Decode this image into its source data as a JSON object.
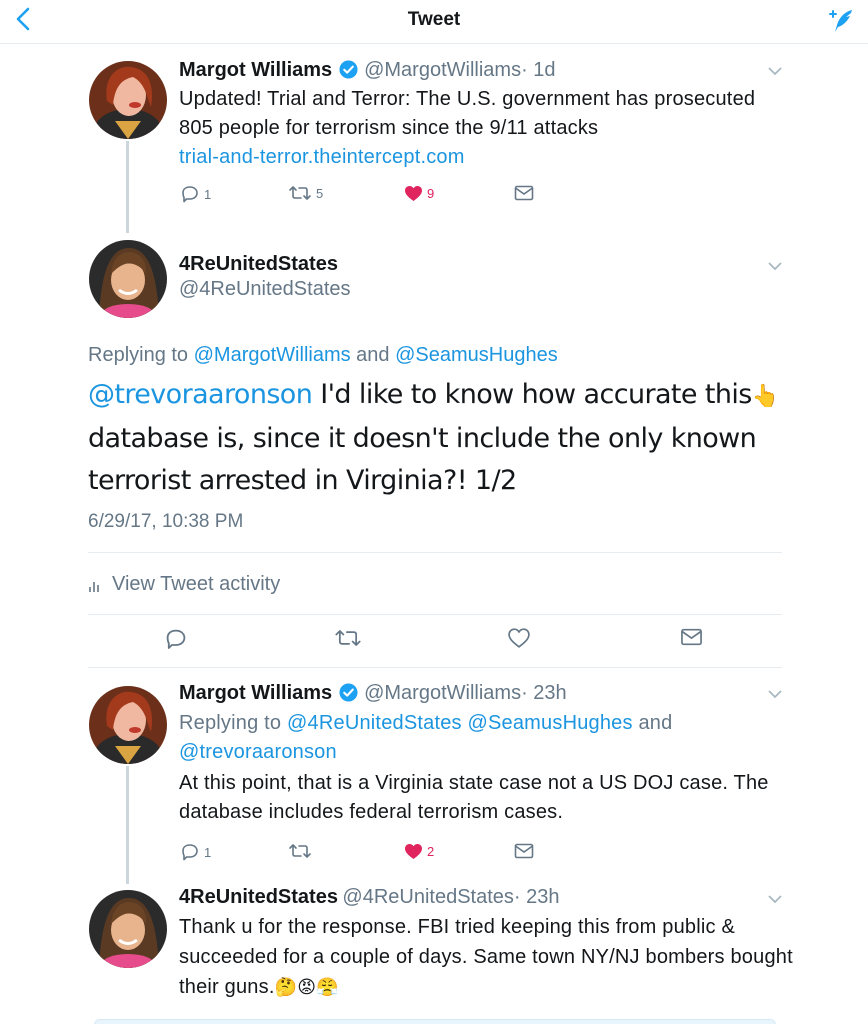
{
  "header": {
    "title": "Tweet"
  },
  "tweet1": {
    "name": "Margot Williams",
    "handle": "@MargotWilliams",
    "time": "· 1d",
    "text": "Updated! Trial and Terror: The U.S. government has prosecuted 805 people for terrorism since the 9/11 attacks",
    "link": "trial-and-terror.theintercept.com",
    "replies": "1",
    "retweets": "5",
    "likes": "9"
  },
  "main": {
    "name": "4ReUnitedStates",
    "handle": "@4ReUnitedStates",
    "replying_prefix": "Replying to",
    "replying_user1": "@MargotWilliams",
    "replying_and": "and",
    "replying_user2": "@SeamusHughes",
    "mention": "@trevoraaronson",
    "text_part1": " I'd like to know how accurate this",
    "text_part2": "database is, since it doesn't include the only known terrorist arrested in Virginia?! 1/2",
    "pointing_emoji": "👆",
    "timestamp": "6/29/17, 10:38 PM",
    "activity": "View Tweet activity"
  },
  "tweet3": {
    "name": "Margot Williams",
    "handle": "@MargotWilliams",
    "time": "· 23h",
    "replying_prefix": "Replying to",
    "replying_users": "@4ReUnitedStates @SeamusHughes",
    "replying_and": "and",
    "replying_user3": "@trevoraaronson",
    "text": "At this point, that is a Virginia state case not a US DOJ case. The database includes federal terrorism cases.",
    "replies": "1",
    "likes": "2"
  },
  "tweet4": {
    "name": "4ReUnitedStates",
    "handle": "@4ReUnitedStates",
    "time": "· 23h",
    "text": "Thank u for the response. FBI tried keeping this from public & succeeded for a couple of days. Same town NY/NJ bombers bought their guns.",
    "emojis": "🤔😡😤"
  },
  "colors": {
    "accent": "#1da1f2",
    "link": "#1b95e0",
    "like": "#e0245e",
    "muted": "#657786"
  }
}
